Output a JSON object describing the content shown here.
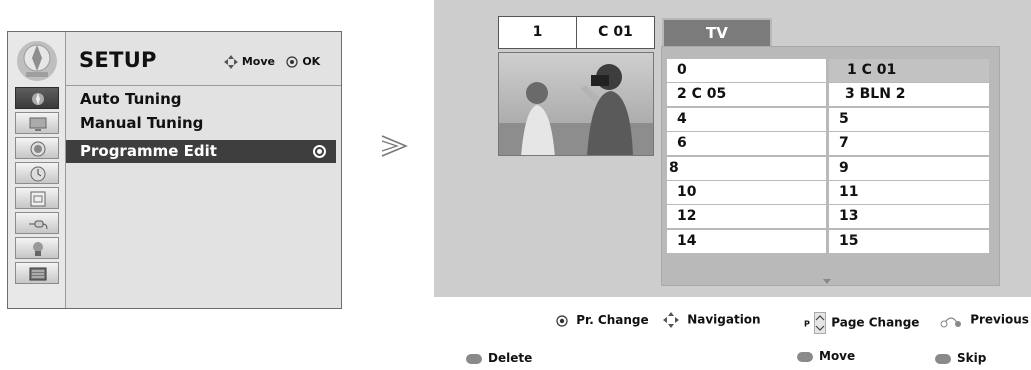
{
  "setup_menu": {
    "title": "SETUP",
    "hint_move": "Move",
    "hint_ok": "OK",
    "items": [
      {
        "label": "Auto Tuning",
        "selected": false
      },
      {
        "label": "Manual Tuning",
        "selected": false
      },
      {
        "label": "Programme Edit",
        "selected": true
      }
    ],
    "side_icons": [
      "setup-icon",
      "picture-icon",
      "audio-icon",
      "time-icon",
      "option-icon",
      "input-icon",
      "lock-icon",
      "usb-icon"
    ]
  },
  "programme_edit": {
    "current_pr": "1",
    "current_channel": "C 01",
    "tab_label": "TV",
    "channels": [
      {
        "left": "0",
        "right": "1 C 01",
        "right_selected": true
      },
      {
        "left": "2 C 05",
        "right": "3 BLN 2"
      },
      {
        "left": "4",
        "right": "5"
      },
      {
        "left": "6",
        "right": "7"
      },
      {
        "left": "8",
        "right": "9"
      },
      {
        "left": "10",
        "right": "11"
      },
      {
        "left": "12",
        "right": "13"
      },
      {
        "left": "14",
        "right": "15"
      }
    ]
  },
  "legend": {
    "pr_change": "Pr. Change",
    "navigation": "Navigation",
    "page_change_prefix": "P",
    "page_change": "Page Change",
    "previous": "Previous",
    "delete": "Delete",
    "move": "Move",
    "skip": "Skip"
  },
  "colors": {
    "panel_bg": "#cdcdcd",
    "selected_menu_bg": "#3e3e3e",
    "tab_bg": "#7b7b7b",
    "selected_cell": "#c2c2c2"
  }
}
